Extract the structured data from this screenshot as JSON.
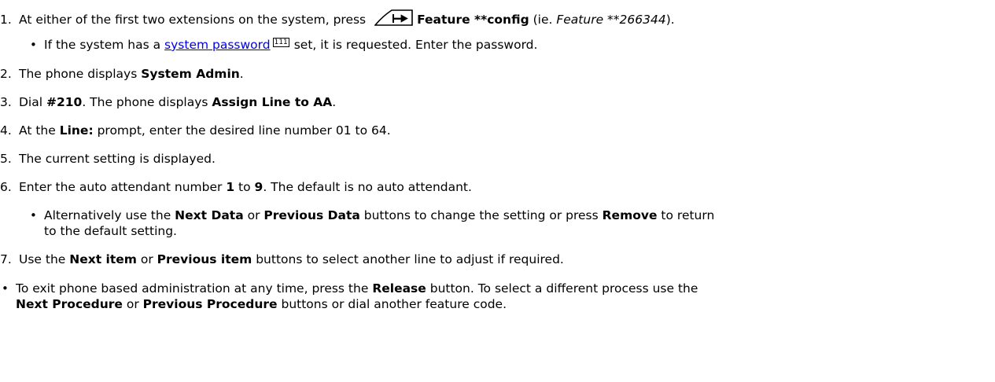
{
  "steps": [
    {
      "num": "1.",
      "t1": "At either of the first two extensions on the system, press ",
      "key_icon": "feature-key-icon",
      "b1": "Feature **config",
      "t2": " (ie. ",
      "i1": "Feature **266344",
      "t3": ").",
      "sub": {
        "t1": "If the system has a ",
        "link": "system password",
        "pageref": "111",
        "t2": " set, it is requested. Enter the password."
      }
    },
    {
      "num": "2.",
      "t1": "The phone displays ",
      "b1": "System Admin",
      "t2": "."
    },
    {
      "num": "3.",
      "t1": "Dial ",
      "b1": "#210",
      "t2": ". The phone displays ",
      "b2": "Assign Line to AA",
      "t3": "."
    },
    {
      "num": "4.",
      "t1": "At the ",
      "b1": "Line:",
      "t2": " prompt, enter the desired line number 01 to 64."
    },
    {
      "num": "5.",
      "t1": "The current setting is displayed."
    },
    {
      "num": "6.",
      "t1": "Enter the auto attendant number ",
      "b1": "1",
      "t2": " to ",
      "b2": "9",
      "t3": ". The default is no auto attendant.",
      "sub": {
        "t1": "Alternatively use the ",
        "b1": "Next Data",
        "t2": " or ",
        "b2": "Previous Data",
        "t3": " buttons to change the setting or press ",
        "b3": "Remove",
        "t4": " to return",
        "line2": "to the default setting."
      }
    },
    {
      "num": "7.",
      "t1": "Use the ",
      "b1": "Next item",
      "t2": " or ",
      "b2": "Previous item",
      "t3": " buttons to select another line to adjust if required."
    }
  ],
  "note": {
    "t1": "To exit phone based administration at any time, press the ",
    "b1": "Release",
    "t2": " button. To select a different process use the",
    "b2": "Next Procedure",
    "t3": " or ",
    "b3": "Previous Procedure",
    "t4": " buttons or dial another feature code."
  }
}
